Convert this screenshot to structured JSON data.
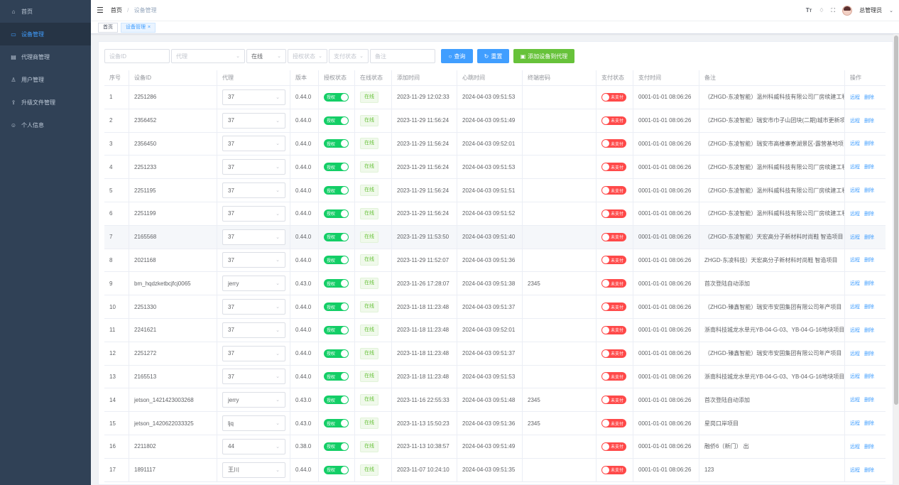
{
  "sidebar": {
    "items": [
      {
        "label": "首页",
        "icon": "home-icon",
        "active": false
      },
      {
        "label": "设备管理",
        "icon": "device-icon",
        "active": true
      },
      {
        "label": "代理商管理",
        "icon": "agent-icon",
        "active": false
      },
      {
        "label": "用户管理",
        "icon": "user-icon",
        "active": false
      },
      {
        "label": "升级文件管理",
        "icon": "upgrade-icon",
        "active": false
      },
      {
        "label": "个人信息",
        "icon": "profile-icon",
        "active": false
      }
    ]
  },
  "header": {
    "breadcrumb": [
      "首页",
      "设备管理"
    ],
    "user_name": "总管理员"
  },
  "tags": [
    {
      "label": "首页",
      "active": false
    },
    {
      "label": "设备管理",
      "active": true
    }
  ],
  "filters": {
    "device_id_placeholder": "设备ID",
    "agent_placeholder": "代理",
    "online_value": "在线",
    "auth_placeholder": "授权状态",
    "pay_placeholder": "支付状态",
    "remark_placeholder": "备注",
    "query_label": "查询",
    "reset_label": "重置",
    "add_label": "添加设备到代理"
  },
  "table": {
    "headers": [
      "序号",
      "设备ID",
      "代理",
      "版本",
      "授权状态",
      "在线状态",
      "添加时间",
      "心跳时间",
      "终端密码",
      "支付状态",
      "支付时间",
      "备注",
      "操作"
    ],
    "auth_label": "授权",
    "online_label": "在线",
    "unpaid_label": "未支付",
    "op_remote": "远程",
    "op_delete": "删除",
    "rows": [
      {
        "no": "1",
        "id": "2251286",
        "agent": "37",
        "ver": "0.44.0",
        "added": "2023-11-29 12:02:33",
        "beat": "2024-04-03 09:51:53",
        "pwd": "",
        "paytime": "0001-01-01 08:06:26",
        "remark": "（ZHGD-东凌智能）温州科威科技有限公司厂房续建工程"
      },
      {
        "no": "2",
        "id": "2356452",
        "agent": "37",
        "ver": "0.44.0",
        "added": "2023-11-29 11:56:24",
        "beat": "2024-04-03 09:51:49",
        "pwd": "",
        "paytime": "0001-01-01 08:06:26",
        "remark": "（ZHGD-东凌智能）瑞安市巾子山团块(二期)城市更新项目"
      },
      {
        "no": "3",
        "id": "2356450",
        "agent": "37",
        "ver": "0.44.0",
        "added": "2023-11-29 11:56:24",
        "beat": "2024-04-03 09:52:01",
        "pwd": "",
        "paytime": "0001-01-01 08:06:26",
        "remark": "（ZHGD-东凌智能）瑞安市高楼寨寮湖景区-露营基地项目"
      },
      {
        "no": "4",
        "id": "2251233",
        "agent": "37",
        "ver": "0.44.0",
        "added": "2023-11-29 11:56:24",
        "beat": "2024-04-03 09:51:53",
        "pwd": "",
        "paytime": "0001-01-01 08:06:26",
        "remark": "（ZHGD-东凌智能）温州科威科技有限公司厂房续建工程"
      },
      {
        "no": "5",
        "id": "2251195",
        "agent": "37",
        "ver": "0.44.0",
        "added": "2023-11-29 11:56:24",
        "beat": "2024-04-03 09:51:51",
        "pwd": "",
        "paytime": "0001-01-01 08:06:26",
        "remark": "（ZHGD-东凌智能）温州科威科技有限公司厂房续建工程"
      },
      {
        "no": "6",
        "id": "2251199",
        "agent": "37",
        "ver": "0.44.0",
        "added": "2023-11-29 11:56:24",
        "beat": "2024-04-03 09:51:52",
        "pwd": "",
        "paytime": "0001-01-01 08:06:26",
        "remark": "（ZHGD-东凌智能）温州科威科技有限公司厂房续建工程"
      },
      {
        "no": "7",
        "id": "2165568",
        "agent": "37",
        "ver": "0.44.0",
        "added": "2023-11-29 11:53:50",
        "beat": "2024-04-03 09:51:40",
        "pwd": "",
        "paytime": "0001-01-01 08:06:26",
        "remark": "（ZHGD-东凌智能）天宏高分子新材料时尚鞋 智造项目"
      },
      {
        "no": "8",
        "id": "2021168",
        "agent": "37",
        "ver": "0.44.0",
        "added": "2023-11-29 11:52:07",
        "beat": "2024-04-03 09:51:36",
        "pwd": "",
        "paytime": "0001-01-01 08:06:26",
        "remark": "ZHGD-东凌科技）天宏高分子新材料时尚鞋 智造项目"
      },
      {
        "no": "9",
        "id": "bm_hqdzketbcjfcj0065",
        "agent": "jerry",
        "ver": "0.43.0",
        "added": "2023-11-26 17:28:07",
        "beat": "2024-04-03 09:51:38",
        "pwd": "2345",
        "paytime": "0001-01-01 08:06:26",
        "remark": "首次登陆自动添加"
      },
      {
        "no": "10",
        "id": "2251330",
        "agent": "37",
        "ver": "0.44.0",
        "added": "2023-11-18 11:23:48",
        "beat": "2024-04-03 09:51:37",
        "pwd": "",
        "paytime": "0001-01-01 08:06:26",
        "remark": "（ZHGD-臻鑫智能）瑞安市安固集团有限公司年产项目"
      },
      {
        "no": "11",
        "id": "2241621",
        "agent": "37",
        "ver": "0.44.0",
        "added": "2023-11-18 11:23:48",
        "beat": "2024-04-03 09:52:01",
        "pwd": "",
        "paytime": "0001-01-01 08:06:26",
        "remark": "浙南科技城龙水单元YB-04-G-03、YB-04-G-16地块项目"
      },
      {
        "no": "12",
        "id": "2251272",
        "agent": "37",
        "ver": "0.44.0",
        "added": "2023-11-18 11:23:48",
        "beat": "2024-04-03 09:51:37",
        "pwd": "",
        "paytime": "0001-01-01 08:06:26",
        "remark": "（ZHGD-臻鑫智能）瑞安市安固集团有限公司年产项目"
      },
      {
        "no": "13",
        "id": "2165513",
        "agent": "37",
        "ver": "0.44.0",
        "added": "2023-11-18 11:23:48",
        "beat": "2024-04-03 09:51:53",
        "pwd": "",
        "paytime": "0001-01-01 08:06:26",
        "remark": "浙南科技城龙水单元YB-04-G-03、YB-04-G-16地块项目"
      },
      {
        "no": "14",
        "id": "jetson_1421423003268",
        "agent": "jerry",
        "ver": "0.43.0",
        "added": "2023-11-16 22:55:33",
        "beat": "2024-04-03 09:51:48",
        "pwd": "2345",
        "paytime": "0001-01-01 08:06:26",
        "remark": "首次登陆自动添加"
      },
      {
        "no": "15",
        "id": "jetson_1420622033325",
        "agent": "ljq",
        "ver": "0.43.0",
        "added": "2023-11-13 15:50:23",
        "beat": "2024-04-03 09:51:36",
        "pwd": "2345",
        "paytime": "0001-01-01 08:06:26",
        "remark": "星岗口岸项目"
      },
      {
        "no": "16",
        "id": "2211802",
        "agent": "44",
        "ver": "0.38.0",
        "added": "2023-11-13 10:38:57",
        "beat": "2024-04-03 09:51:49",
        "pwd": "",
        "paytime": "0001-01-01 08:06:26",
        "remark": "融侨6（新门） 出"
      },
      {
        "no": "17",
        "id": "1891117",
        "agent": "王川",
        "ver": "0.44.0",
        "added": "2023-11-07 10:24:10",
        "beat": "2024-04-03 09:51:35",
        "pwd": "",
        "paytime": "0001-01-01 08:06:26",
        "remark": "123"
      }
    ]
  }
}
